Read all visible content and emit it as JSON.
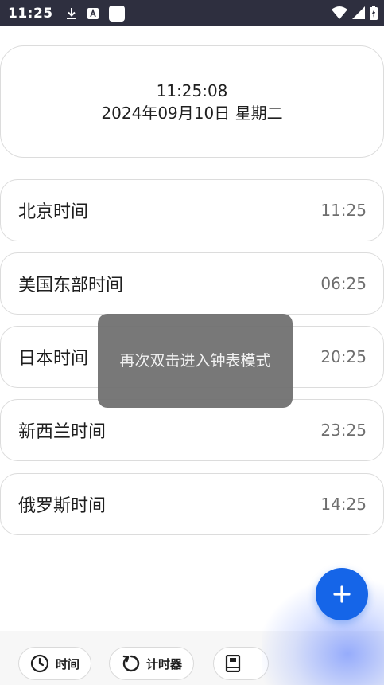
{
  "status_bar": {
    "time": "11:25"
  },
  "clock": {
    "time": "11:25:08",
    "date": "2024年09月10日 星期二"
  },
  "zones": [
    {
      "name": "北京时间",
      "time": "11:25"
    },
    {
      "name": "美国东部时间",
      "time": "06:25"
    },
    {
      "name": "日本时间",
      "time": "20:25"
    },
    {
      "name": "新西兰时间",
      "time": "23:25"
    },
    {
      "name": "俄罗斯时间",
      "time": "14:25"
    }
  ],
  "toast": {
    "message": "再次双击进入钟表模式"
  },
  "nav": {
    "time_label": "时间",
    "timer_label": "计时器"
  },
  "icons": {
    "download": "download-icon",
    "a_badge": "a-badge-icon",
    "square": "square-icon",
    "wifi": "wifi-icon",
    "signal": "signal-icon",
    "battery": "battery-icon",
    "clock": "clock-icon",
    "timer": "refresh-icon",
    "book": "book-icon",
    "add": "plus-icon"
  },
  "colors": {
    "status_bar_bg": "#2e2f3f",
    "accent": "#1565e8",
    "toast_bg": "#6e6e6e",
    "muted_text": "#6e6e6e"
  }
}
